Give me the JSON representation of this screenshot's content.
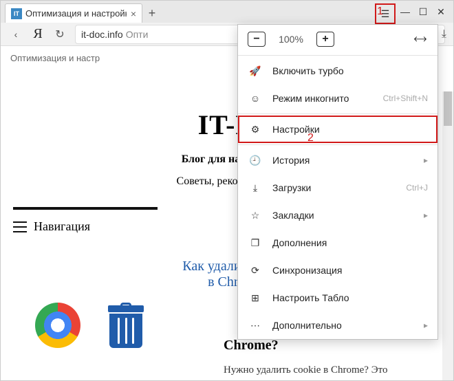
{
  "tab": {
    "favicon_text": "IT",
    "title": "Оптимизация и настройк",
    "close": "×"
  },
  "window": {
    "hamburger": "☰",
    "minimize": "—",
    "maximize": "☐",
    "close": "✕"
  },
  "toolbar": {
    "back": "‹",
    "ya": "Я",
    "reload": "↻",
    "url_host": "it-doc.info",
    "url_rest": "Опти",
    "download": "⤓"
  },
  "annotations": {
    "one": "1",
    "two": "2"
  },
  "page": {
    "breadcrumb": "Оптимизация и настр",
    "title": "IT-D",
    "subtitle": "Блог для начинаю",
    "tagline": "Советы, рекомендаци",
    "nav_label": "Навигация",
    "article_l1": "Как удалить cookie",
    "article_l2": "в Chrome?",
    "bg_heading": "Chrome?",
    "bg_para": "Нужно удалить cookie в Chrome? Это"
  },
  "menu": {
    "zoom_value": "100%",
    "items": [
      {
        "icon": "🚀",
        "label": "Включить турбо",
        "shortcut": "",
        "arrow": false,
        "hl": false,
        "name": "menu-turbo"
      },
      {
        "icon": "☺",
        "label": "Режим инкогнито",
        "shortcut": "Ctrl+Shift+N",
        "arrow": false,
        "hl": false,
        "name": "menu-incognito"
      },
      {
        "icon": "⚙",
        "label": "Настройки",
        "shortcut": "",
        "arrow": false,
        "hl": true,
        "name": "menu-settings"
      },
      {
        "icon": "🕘",
        "label": "История",
        "shortcut": "",
        "arrow": true,
        "hl": false,
        "name": "menu-history"
      },
      {
        "icon": "⤓",
        "label": "Загрузки",
        "shortcut": "Ctrl+J",
        "arrow": false,
        "hl": false,
        "name": "menu-downloads"
      },
      {
        "icon": "☆",
        "label": "Закладки",
        "shortcut": "",
        "arrow": true,
        "hl": false,
        "name": "menu-bookmarks"
      },
      {
        "icon": "❐",
        "label": "Дополнения",
        "shortcut": "",
        "arrow": false,
        "hl": false,
        "name": "menu-addons"
      },
      {
        "icon": "⟳",
        "label": "Синхронизация",
        "shortcut": "",
        "arrow": false,
        "hl": false,
        "name": "menu-sync"
      },
      {
        "icon": "⊞",
        "label": "Настроить Табло",
        "shortcut": "",
        "arrow": false,
        "hl": false,
        "name": "menu-tableau"
      },
      {
        "icon": "⋯",
        "label": "Дополнительно",
        "shortcut": "",
        "arrow": true,
        "hl": false,
        "name": "menu-more"
      }
    ]
  }
}
